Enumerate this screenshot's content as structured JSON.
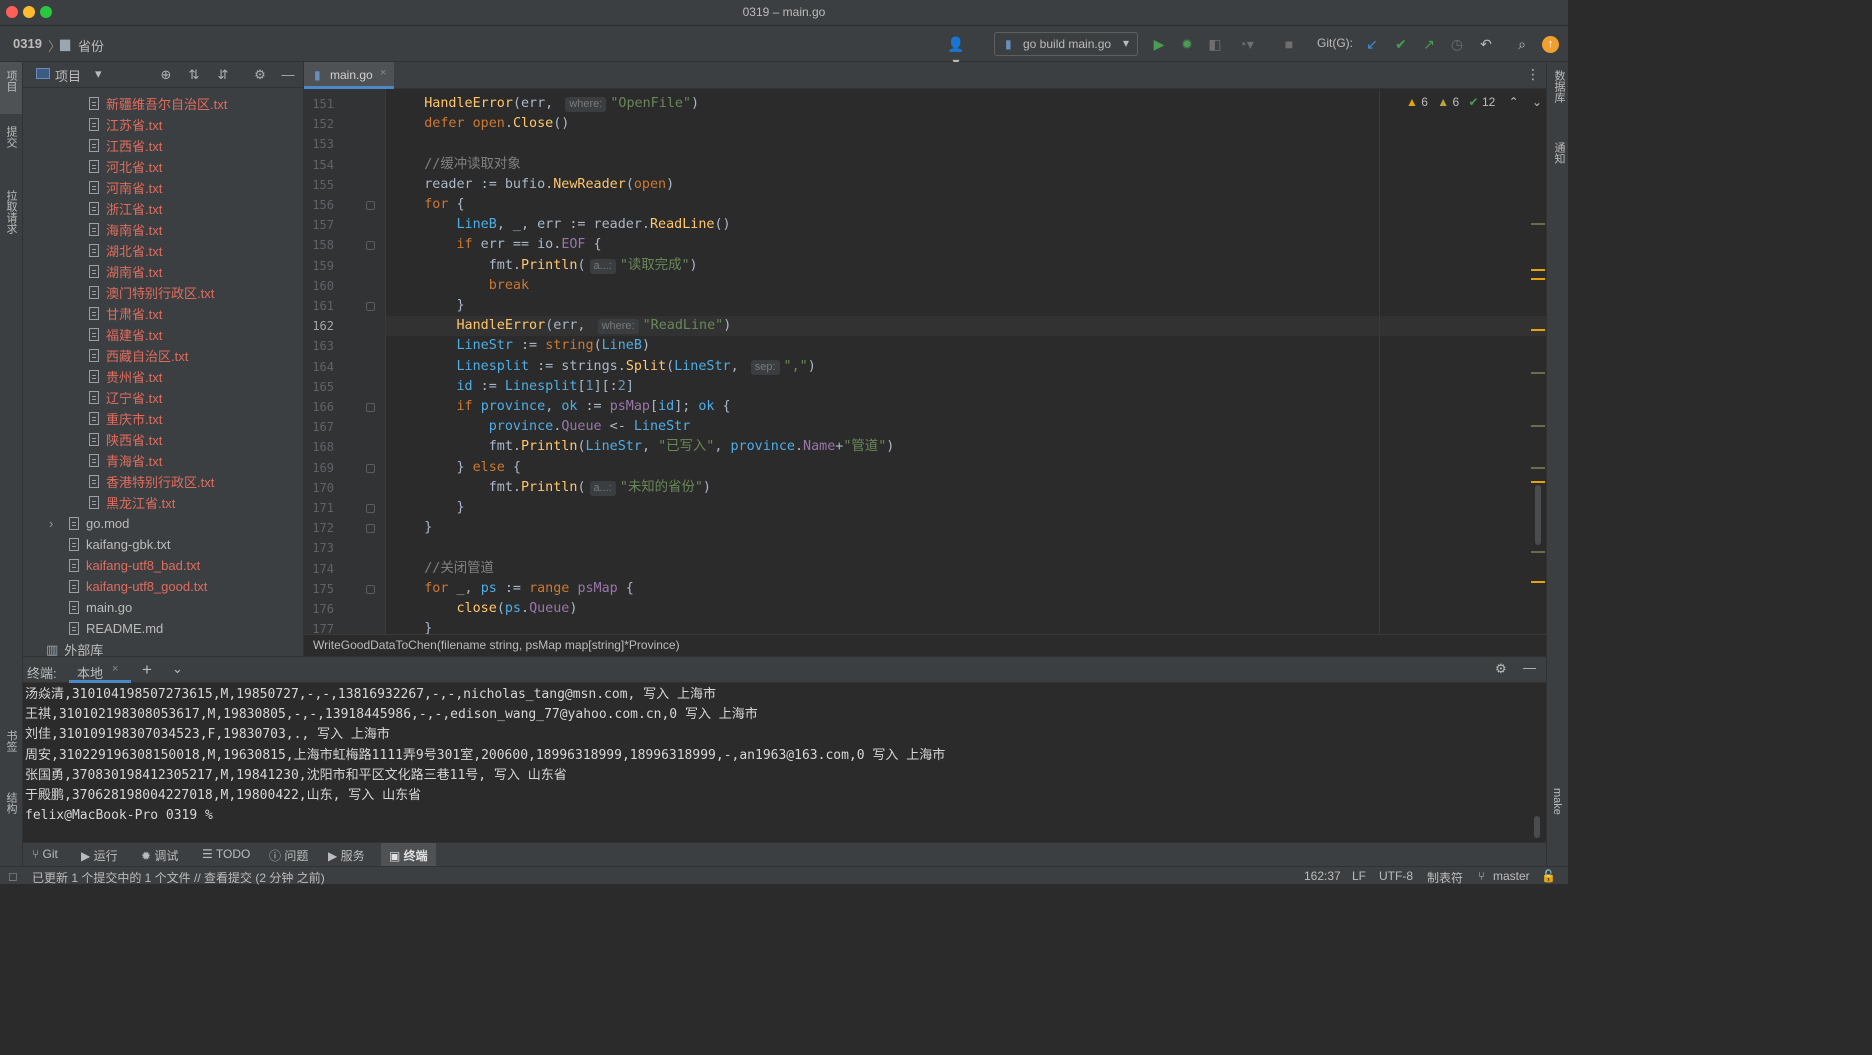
{
  "window": {
    "title": "0319 – main.go"
  },
  "nav": {
    "project": "0319",
    "folder": "省份",
    "run_config": "go build main.go",
    "git_label": "Git(G):"
  },
  "left_tabs": {
    "project": "项目",
    "commit": "提交",
    "pull": "拉取请求",
    "bookmarks": "书签",
    "structure": "结构"
  },
  "right_tabs": {
    "database": "数据库",
    "notifications": "通知",
    "make": "make"
  },
  "project_panel": {
    "title": "项目",
    "files": [
      {
        "name": "新疆维吾尔自治区.txt",
        "color": "#e06c5e",
        "indent": 1
      },
      {
        "name": "江苏省.txt",
        "color": "#e06c5e",
        "indent": 1
      },
      {
        "name": "江西省.txt",
        "color": "#e06c5e",
        "indent": 1
      },
      {
        "name": "河北省.txt",
        "color": "#e06c5e",
        "indent": 1
      },
      {
        "name": "河南省.txt",
        "color": "#e06c5e",
        "indent": 1
      },
      {
        "name": "浙江省.txt",
        "color": "#e06c5e",
        "indent": 1
      },
      {
        "name": "海南省.txt",
        "color": "#e06c5e",
        "indent": 1
      },
      {
        "name": "湖北省.txt",
        "color": "#e06c5e",
        "indent": 1
      },
      {
        "name": "湖南省.txt",
        "color": "#e06c5e",
        "indent": 1
      },
      {
        "name": "澳门特别行政区.txt",
        "color": "#e06c5e",
        "indent": 1
      },
      {
        "name": "甘肃省.txt",
        "color": "#e06c5e",
        "indent": 1
      },
      {
        "name": "福建省.txt",
        "color": "#e06c5e",
        "indent": 1
      },
      {
        "name": "西藏自治区.txt",
        "color": "#e06c5e",
        "indent": 1
      },
      {
        "name": "贵州省.txt",
        "color": "#e06c5e",
        "indent": 1
      },
      {
        "name": "辽宁省.txt",
        "color": "#e06c5e",
        "indent": 1
      },
      {
        "name": "重庆市.txt",
        "color": "#e06c5e",
        "indent": 1
      },
      {
        "name": "陕西省.txt",
        "color": "#e06c5e",
        "indent": 1
      },
      {
        "name": "青海省.txt",
        "color": "#e06c5e",
        "indent": 1
      },
      {
        "name": "香港特别行政区.txt",
        "color": "#e06c5e",
        "indent": 1
      },
      {
        "name": "黑龙江省.txt",
        "color": "#e06c5e",
        "indent": 1
      },
      {
        "name": "go.mod",
        "color": "#bbbbbb",
        "indent": 0,
        "arrow": "›"
      },
      {
        "name": "kaifang-gbk.txt",
        "color": "#bbbbbb",
        "indent": 0
      },
      {
        "name": "kaifang-utf8_bad.txt",
        "color": "#e06c5e",
        "indent": 0
      },
      {
        "name": "kaifang-utf8_good.txt",
        "color": "#e06c5e",
        "indent": 0
      },
      {
        "name": "main.go",
        "color": "#bbbbbb",
        "indent": 0
      },
      {
        "name": "README.md",
        "color": "#bbbbbb",
        "indent": 0
      },
      {
        "name": "外部库",
        "color": "#bbbbbb",
        "indent": -1,
        "arrow": "⌄"
      }
    ]
  },
  "editor": {
    "tab": "main.go",
    "inspections": {
      "warnings": "6",
      "weak": "6",
      "ok": "12"
    },
    "breadcrumb": "WriteGoodDataToChen(filename string, psMap map[string]*Province)",
    "lines": [
      {
        "n": "151",
        "tokens": [
          [
            "    ",
            ""
          ],
          [
            "HandleError",
            "fn"
          ],
          [
            "(err, ",
            ""
          ],
          [
            "where:",
            "hint"
          ],
          [
            "\"OpenFile\"",
            "str"
          ],
          [
            ")",
            ""
          ]
        ]
      },
      {
        "n": "152",
        "tokens": [
          [
            "    ",
            ""
          ],
          [
            "defer",
            "kw"
          ],
          [
            " ",
            ""
          ],
          [
            "open",
            "kw"
          ],
          [
            ".",
            ""
          ],
          [
            "Close",
            "fn"
          ],
          [
            "()",
            ""
          ]
        ]
      },
      {
        "n": "153",
        "tokens": []
      },
      {
        "n": "154",
        "tokens": [
          [
            "    ",
            ""
          ],
          [
            "//缓冲读取对象",
            "cm"
          ]
        ]
      },
      {
        "n": "155",
        "tokens": [
          [
            "    ",
            ""
          ],
          [
            "reader",
            "idn"
          ],
          [
            " := bufio.",
            ""
          ],
          [
            "NewReader",
            "fn"
          ],
          [
            "(",
            ""
          ],
          [
            "open",
            "kw"
          ],
          [
            ")",
            ""
          ]
        ]
      },
      {
        "n": "156",
        "tokens": [
          [
            "    ",
            ""
          ],
          [
            "for",
            "kw"
          ],
          [
            " {",
            ""
          ]
        ]
      },
      {
        "n": "157",
        "tokens": [
          [
            "        ",
            ""
          ],
          [
            "LineB",
            "gn"
          ],
          [
            ", _, ",
            ""
          ],
          [
            "err",
            "idn"
          ],
          [
            " := reader.",
            ""
          ],
          [
            "ReadLine",
            "fn"
          ],
          [
            "()",
            ""
          ]
        ]
      },
      {
        "n": "158",
        "tokens": [
          [
            "        ",
            ""
          ],
          [
            "if",
            "kw"
          ],
          [
            " err == io.",
            ""
          ],
          [
            "EOF",
            "fld"
          ],
          [
            " {",
            ""
          ]
        ]
      },
      {
        "n": "159",
        "tokens": [
          [
            "            ",
            ""
          ],
          [
            "fmt.",
            ""
          ],
          [
            "Println",
            "fn"
          ],
          [
            "(",
            ""
          ],
          [
            "a...:",
            "hint"
          ],
          [
            "\"读取完成\"",
            "str"
          ],
          [
            ")",
            ""
          ]
        ]
      },
      {
        "n": "160",
        "tokens": [
          [
            "            ",
            ""
          ],
          [
            "break",
            "kw"
          ]
        ]
      },
      {
        "n": "161",
        "tokens": [
          [
            "        }",
            ""
          ]
        ]
      },
      {
        "n": "162",
        "tokens": [
          [
            "        ",
            ""
          ],
          [
            "HandleError",
            "fn"
          ],
          [
            "(err, ",
            ""
          ],
          [
            "where:",
            "hint"
          ],
          [
            "\"ReadLine\"",
            "str"
          ],
          [
            ")",
            ""
          ]
        ]
      },
      {
        "n": "163",
        "tokens": [
          [
            "        ",
            ""
          ],
          [
            "LineStr",
            "gn"
          ],
          [
            " := ",
            ""
          ],
          [
            "string",
            "typ"
          ],
          [
            "(",
            ""
          ],
          [
            "LineB",
            "gn"
          ],
          [
            ")",
            ""
          ]
        ]
      },
      {
        "n": "164",
        "tokens": [
          [
            "        ",
            ""
          ],
          [
            "Linesplit",
            "gn"
          ],
          [
            " := strings.",
            ""
          ],
          [
            "Split",
            "fn"
          ],
          [
            "(",
            ""
          ],
          [
            "LineStr",
            "gn"
          ],
          [
            ", ",
            ""
          ],
          [
            "sep:",
            "hint"
          ],
          [
            "\",\"",
            "str"
          ],
          [
            ")",
            ""
          ]
        ]
      },
      {
        "n": "165",
        "tokens": [
          [
            "        ",
            ""
          ],
          [
            "id",
            "gn"
          ],
          [
            " := ",
            ""
          ],
          [
            "Linesplit",
            "gn"
          ],
          [
            "[",
            ""
          ],
          [
            "1",
            "num"
          ],
          [
            "][:",
            ""
          ],
          [
            "2",
            "num"
          ],
          [
            "]",
            ""
          ]
        ]
      },
      {
        "n": "166",
        "tokens": [
          [
            "        ",
            ""
          ],
          [
            "if",
            "kw"
          ],
          [
            " ",
            ""
          ],
          [
            "province",
            "gn"
          ],
          [
            ", ",
            ""
          ],
          [
            "ok",
            "gn"
          ],
          [
            " := ",
            ""
          ],
          [
            "psMap",
            "fld"
          ],
          [
            "[",
            ""
          ],
          [
            "id",
            "gn"
          ],
          [
            "]; ",
            ""
          ],
          [
            "ok",
            "gn"
          ],
          [
            " {",
            ""
          ]
        ]
      },
      {
        "n": "167",
        "tokens": [
          [
            "            ",
            ""
          ],
          [
            "province",
            "gn"
          ],
          [
            ".",
            ""
          ],
          [
            "Queue",
            "fld"
          ],
          [
            " <- ",
            ""
          ],
          [
            "LineStr",
            "gn"
          ]
        ]
      },
      {
        "n": "168",
        "tokens": [
          [
            "            ",
            ""
          ],
          [
            "fmt.",
            ""
          ],
          [
            "Println",
            "fn"
          ],
          [
            "(",
            ""
          ],
          [
            "LineStr",
            "gn"
          ],
          [
            ", ",
            ""
          ],
          [
            "\"已写入\"",
            "str"
          ],
          [
            ", ",
            ""
          ],
          [
            "province",
            "gn"
          ],
          [
            ".",
            ""
          ],
          [
            "Name",
            "fld"
          ],
          [
            "+",
            ""
          ],
          [
            "\"管道\"",
            "str"
          ],
          [
            ")",
            ""
          ]
        ]
      },
      {
        "n": "169",
        "tokens": [
          [
            "        } ",
            ""
          ],
          [
            "else",
            "kw"
          ],
          [
            " {",
            ""
          ]
        ]
      },
      {
        "n": "170",
        "tokens": [
          [
            "            ",
            ""
          ],
          [
            "fmt.",
            ""
          ],
          [
            "Println",
            "fn"
          ],
          [
            "(",
            ""
          ],
          [
            "a...:",
            "hint"
          ],
          [
            "\"未知的省份\"",
            "str"
          ],
          [
            ")",
            ""
          ]
        ]
      },
      {
        "n": "171",
        "tokens": [
          [
            "        }",
            ""
          ]
        ]
      },
      {
        "n": "172",
        "tokens": [
          [
            "    }",
            ""
          ]
        ]
      },
      {
        "n": "173",
        "tokens": []
      },
      {
        "n": "174",
        "tokens": [
          [
            "    ",
            ""
          ],
          [
            "//关闭管道",
            "cm"
          ]
        ]
      },
      {
        "n": "175",
        "tokens": [
          [
            "    ",
            ""
          ],
          [
            "for",
            "kw"
          ],
          [
            " _, ",
            ""
          ],
          [
            "ps",
            "gn"
          ],
          [
            " := ",
            ""
          ],
          [
            "range",
            "kw"
          ],
          [
            " ",
            ""
          ],
          [
            "psMap",
            "fld"
          ],
          [
            " {",
            ""
          ]
        ]
      },
      {
        "n": "176",
        "tokens": [
          [
            "        ",
            ""
          ],
          [
            "close",
            "fn"
          ],
          [
            "(",
            ""
          ],
          [
            "ps",
            "gn"
          ],
          [
            ".",
            ""
          ],
          [
            "Queue",
            "fld"
          ],
          [
            ")",
            ""
          ]
        ]
      },
      {
        "n": "177",
        "tokens": [
          [
            "    }",
            ""
          ]
        ]
      }
    ]
  },
  "terminal": {
    "title": "终端:",
    "tab": "本地",
    "lines": [
      "汤焱清,310104198507273615,M,19850727,-,-,13816932267,-,-,nicholas_tang@msn.com, 写入 上海市",
      "王祺,310102198308053617,M,19830805,-,-,13918445986,-,-,edison_wang_77@yahoo.com.cn,0 写入 上海市",
      "刘佳,310109198307034523,F,19830703,., 写入 上海市",
      "周安,310229196308150018,M,19630815,上海市虹梅路1111弄9号301室,200600,18996318999,18996318999,-,an1963@163.com,0 写入 上海市",
      "张国勇,370830198412305217,M,19841230,沈阳市和平区文化路三巷11号, 写入 山东省",
      "于殿鹏,370628198004227018,M,19800422,山东, 写入 山东省",
      "felix@MacBook-Pro 0319 % "
    ]
  },
  "toolwindows": {
    "git": "Git",
    "run": "运行",
    "debug": "调试",
    "todo": "TODO",
    "problems": "问题",
    "services": "服务",
    "terminal": "终端"
  },
  "status": {
    "message": "已更新 1 个提交中的 1 个文件 // 查看提交 (2 分钟 之前)",
    "position": "162:37",
    "line_sep": "LF",
    "encoding": "UTF-8",
    "indent": "制表符",
    "branch": "master"
  }
}
